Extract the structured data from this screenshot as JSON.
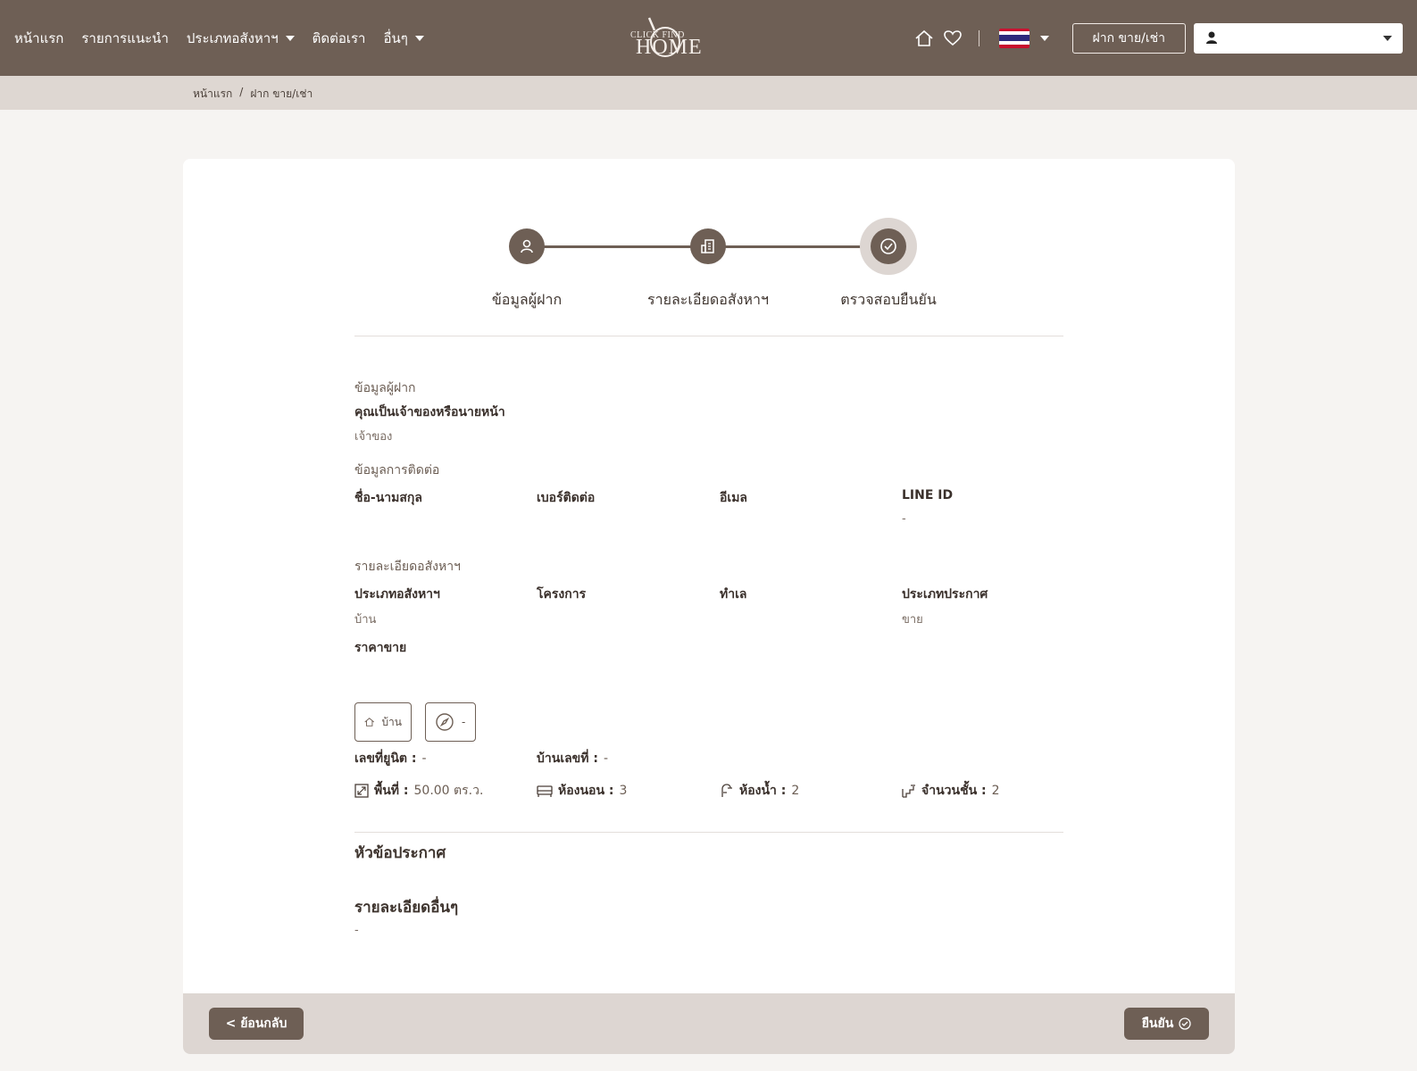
{
  "nav": {
    "links": [
      {
        "label": "หน้าแรก"
      },
      {
        "label": "รายการแนะนำ"
      },
      {
        "label": "ประเภทอสังหาฯ"
      },
      {
        "label": "ติดต่อเรา"
      },
      {
        "label": "อื่นๆ"
      }
    ],
    "logo_line1": "CLICK  FIND",
    "logo_line2": "HOME",
    "post_button": "ฝาก ขาย/เช่า",
    "user_name": "",
    "colors": {
      "nav_bg": "#6e5f55",
      "accent": "#6e5f55"
    }
  },
  "breadcrumb": {
    "home": "หน้าแรก",
    "sep": "/",
    "current": "ฝาก ขาย/เช่า"
  },
  "steps": [
    {
      "label": "ข้อมูลผู้ฝาก",
      "icon": "user-icon"
    },
    {
      "label": "รายละเอียดอสังหาฯ",
      "icon": "building-icon"
    },
    {
      "label": "ตรวจสอบยืนยัน",
      "icon": "check-circle-icon",
      "active": true
    }
  ],
  "depositor": {
    "section_title": "ข้อมูลผู้ฝาก",
    "owner_question": "คุณเป็นเจ้าของหรือนายหน้า",
    "owner_value": "เจ้าของ"
  },
  "contact": {
    "section_title": "ข้อมูลการติดต่อ",
    "name_label": "ชื่อ-นามสกุล",
    "name_value": "",
    "phone_label": "เบอร์ติดต่อ",
    "phone_value": "",
    "email_label": "อีเมล",
    "email_value": "",
    "line_label": "LINE ID",
    "line_value": "-"
  },
  "property": {
    "section_title": "รายละเอียดอสังหาฯ",
    "type_label": "ประเภทอสังหาฯ",
    "type_value": "บ้าน",
    "project_label": "โครงการ",
    "project_value": "",
    "location_label": "ทำเล",
    "location_value": "",
    "listing_type_label": "ประเภทประกาศ",
    "listing_type_value": "ขาย",
    "price_label": "ราคาขาย",
    "price_value": "",
    "chip_type": "บ้าน",
    "chip_location": "-",
    "unit_no_label": "เลขที่ยูนิต :",
    "unit_no_value": "-",
    "house_no_label": "บ้านเลขที่ :",
    "house_no_value": "-",
    "area_label": "พื้นที่ :",
    "area_value": "50.00 ตร.ว.",
    "bedrooms_label": "ห้องนอน :",
    "bedrooms_value": "3",
    "bathrooms_label": "ห้องน้ำ :",
    "bathrooms_value": "2",
    "floors_label": "จำนวนชั้น :",
    "floors_value": "2"
  },
  "announcement": {
    "title_label": "หัวข้อประกาศ",
    "title_value": "",
    "details_label": "รายละเอียดอื่นๆ",
    "details_value": "-"
  },
  "footer": {
    "back_button": "< ย้อนกลับ",
    "confirm_button": "ยืนยัน"
  }
}
